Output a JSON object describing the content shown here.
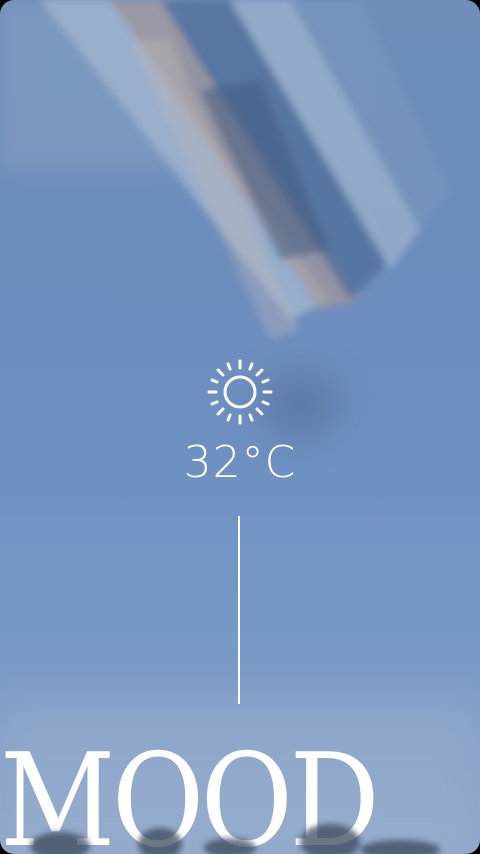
{
  "weather": {
    "icon": "sun-icon",
    "temperature": "32°C"
  },
  "brand": {
    "wordmark": "MOOD"
  },
  "colors": {
    "sky_top": "#6f8fb9",
    "sky_bottom": "#8fa7c9",
    "foreground": "#ffffff"
  }
}
